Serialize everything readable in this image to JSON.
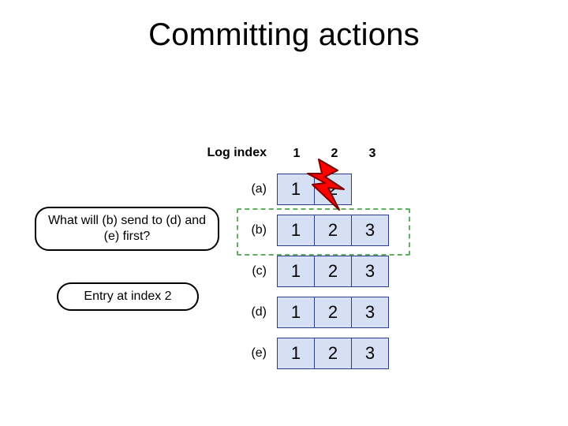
{
  "title": "Committing actions",
  "log_index_label": "Log index",
  "columns": [
    "1",
    "2",
    "3"
  ],
  "rows": [
    {
      "label": "(a)",
      "cells": [
        "1",
        "2",
        ""
      ]
    },
    {
      "label": "(b)",
      "cells": [
        "1",
        "2",
        "3"
      ]
    },
    {
      "label": "(c)",
      "cells": [
        "1",
        "2",
        "3"
      ]
    },
    {
      "label": "(d)",
      "cells": [
        "1",
        "2",
        "3"
      ]
    },
    {
      "label": "(e)",
      "cells": [
        "1",
        "2",
        "3"
      ]
    }
  ],
  "callouts": {
    "question": "What will (b) send to (d) and (e) first?",
    "answer": "Entry at index 2"
  },
  "icons": {
    "bolt": "lightning-bolt"
  },
  "colors": {
    "cell_fill": "#d6e0f5",
    "cell_border": "#2c3d8f",
    "dash": "#5fb05f",
    "bolt_fill": "#ff0000",
    "bolt_stroke": "#7a0000"
  }
}
